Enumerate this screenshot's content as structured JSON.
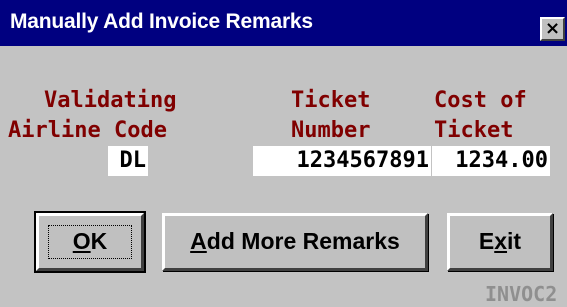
{
  "window": {
    "title": "Manually Add Invoice Remarks",
    "close_glyph": "×",
    "form_id": "INVOC2"
  },
  "columns": {
    "validating": {
      "line1": "Validating",
      "line2": "Airline Code"
    },
    "ticket": {
      "line1": "Ticket",
      "line2": "Number"
    },
    "cost": {
      "line1": "Cost of",
      "line2": "Ticket"
    }
  },
  "fields": {
    "airline_code": "DL",
    "ticket_number": "1234567891",
    "cost": "1234.00"
  },
  "buttons": {
    "ok": {
      "mnemonic": "O",
      "rest": "K"
    },
    "add_more": {
      "mnemonic": "A",
      "rest": "dd More Remarks"
    },
    "exit": {
      "pre": "E",
      "mnemonic": "x",
      "rest": "it"
    }
  },
  "colors": {
    "title_bar": "#000080",
    "label_text": "#800000",
    "window_bg": "#c3c3c3"
  }
}
